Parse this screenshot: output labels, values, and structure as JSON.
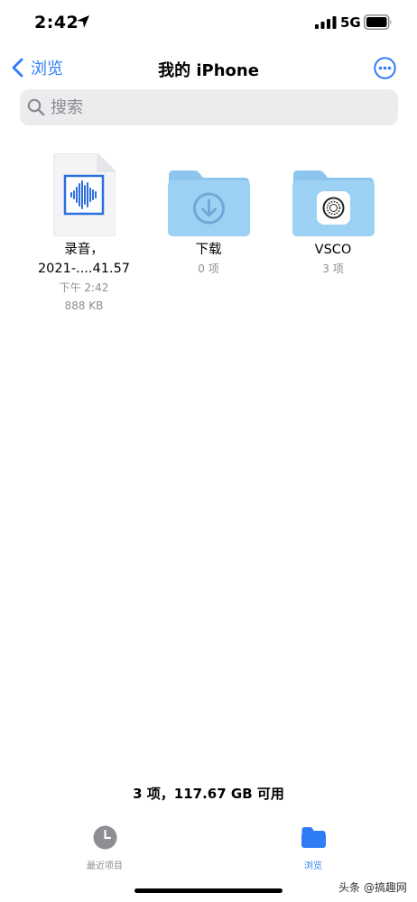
{
  "status_bar": {
    "time": "2:42",
    "network": "5G",
    "icons": [
      "location-arrow-icon",
      "cellular-signal-icon",
      "battery-icon"
    ]
  },
  "nav": {
    "back_label": "浏览",
    "title": "我的 iPhone",
    "more_icon": "ellipsis-circle-icon"
  },
  "search": {
    "placeholder": "搜索"
  },
  "items": [
    {
      "name_line1": "录音，",
      "name_line2": "2021-....41.57",
      "time": "下午 2:42",
      "size": "888 KB",
      "icon": "audio-waveform-icon"
    },
    {
      "name": "下载",
      "count": "0 项",
      "icon": "download-arrow-icon"
    },
    {
      "name": "VSCO",
      "count": "3 项",
      "icon": "vsco-app-icon"
    }
  ],
  "footer": {
    "storage": "3 项，117.67 GB 可用"
  },
  "tabs": [
    {
      "label": "最近项目",
      "icon": "clock-icon",
      "active": false
    },
    {
      "label": "浏览",
      "icon": "folder-icon",
      "active": true
    }
  ],
  "watermark": "头条 @搞趣网",
  "colors": {
    "accent": "#2f7cf6",
    "folder": "#9dd1f4",
    "folder_tab": "#8cc6ef",
    "secondary_text": "#8e8e93",
    "search_bg": "#ececee"
  }
}
